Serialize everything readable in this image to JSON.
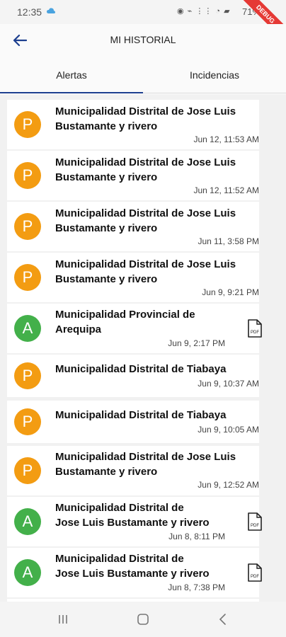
{
  "status_bar": {
    "time": "12:35",
    "battery": "71%",
    "debug_banner": "DEBUG"
  },
  "app_bar": {
    "title": "MI HISTORIAL"
  },
  "tabs": [
    {
      "label": "Alertas",
      "selected": true
    },
    {
      "label": "Incidencias",
      "selected": false
    }
  ],
  "colors": {
    "accent": "#1d3f8f",
    "avatar_orange": "#f39c12",
    "avatar_green": "#43b04a"
  },
  "alerts": [
    {
      "initial": "P",
      "title_line1": "Municipalidad Distrital de Jose Luis",
      "title_line2": "Bustamante y rivero",
      "date": "Jun 12, 11:53 AM",
      "has_pdf": false
    },
    {
      "initial": "P",
      "title_line1": "Municipalidad Distrital de Jose Luis",
      "title_line2": "Bustamante y rivero",
      "date": "Jun 12, 11:52 AM",
      "has_pdf": false
    },
    {
      "initial": "P",
      "title_line1": "Municipalidad Distrital de Jose Luis",
      "title_line2": "Bustamante y rivero",
      "date": "Jun 11, 3:58 PM",
      "has_pdf": false
    },
    {
      "initial": "P",
      "title_line1": "Municipalidad Distrital de Jose Luis",
      "title_line2": "Bustamante y rivero",
      "date": "Jun 9, 9:21 PM",
      "has_pdf": false
    },
    {
      "initial": "A",
      "title_line1": "Municipalidad Provincial de",
      "title_line2": "Arequipa",
      "date": "Jun 9, 2:17 PM",
      "has_pdf": true
    },
    {
      "initial": "P",
      "title_line1": "Municipalidad Distrital de Tiabaya",
      "title_line2": "",
      "date": "Jun 9, 10:37 AM",
      "has_pdf": false
    },
    {
      "initial": "P",
      "title_line1": "Municipalidad Distrital de Tiabaya",
      "title_line2": "",
      "date": "Jun 9, 10:05 AM",
      "has_pdf": false
    },
    {
      "initial": "P",
      "title_line1": "Municipalidad Distrital de Jose Luis",
      "title_line2": "Bustamante y rivero",
      "date": "Jun 9, 12:52 AM",
      "has_pdf": false
    },
    {
      "initial": "A",
      "title_line1": "Municipalidad Distrital de",
      "title_line2": "Jose Luis Bustamante y rivero",
      "date": "Jun 8, 8:11 PM",
      "has_pdf": true
    },
    {
      "initial": "A",
      "title_line1": "Municipalidad Distrital de",
      "title_line2": "Jose Luis Bustamante y rivero",
      "date": "Jun 8, 7:38 PM",
      "has_pdf": true
    }
  ]
}
